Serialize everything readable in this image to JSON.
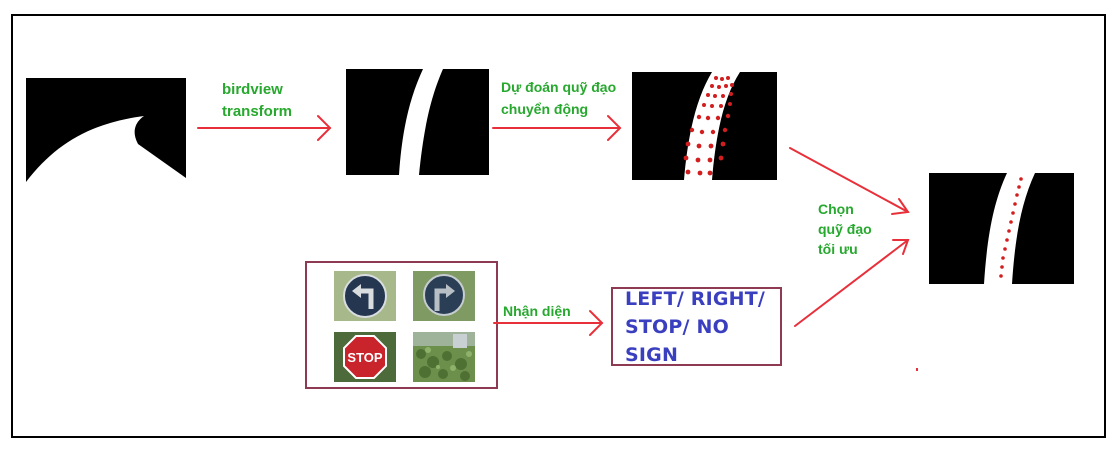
{
  "labels": {
    "birdview_line1": "birdview",
    "birdview_line2": "transform",
    "predict_line1": "Dự đoán quỹ đạo",
    "predict_line2": "chuyển động",
    "choose_line1": "Chọn",
    "choose_line2": "quỹ đạo",
    "choose_line3": "tối ưu",
    "recognize": "Nhận diện"
  },
  "signs": {
    "stop_text": "STOP"
  },
  "result": {
    "line1": "LEFT/ RIGHT/",
    "line2": "STOP/ NO SIGN"
  },
  "colors": {
    "label_green": "#27a82e",
    "arrow_red": "#e8303a",
    "result_blue": "#3a3fbf",
    "box_border": "#8d3a52"
  }
}
